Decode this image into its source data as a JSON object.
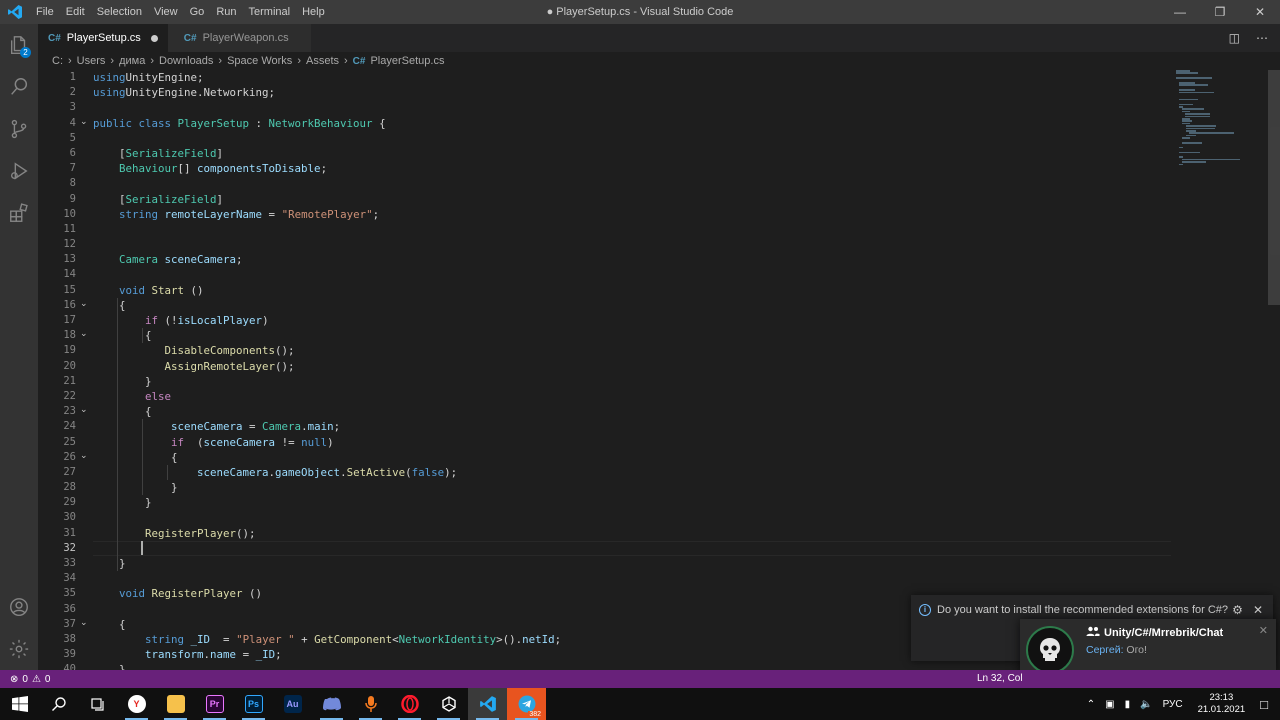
{
  "window": {
    "title": "● PlayerSetup.cs - Visual Studio Code",
    "menu": [
      "File",
      "Edit",
      "Selection",
      "View",
      "Go",
      "Run",
      "Terminal",
      "Help"
    ]
  },
  "activity_bar": {
    "items": [
      "explorer-icon",
      "search-icon",
      "source-control-icon",
      "run-debug-icon",
      "extensions-icon"
    ],
    "explorer_badge": "2",
    "bottom": [
      "account-icon",
      "settings-gear-icon"
    ]
  },
  "tabs": [
    {
      "label": "PlayerSetup.cs",
      "icon": "C#",
      "dirty": true,
      "active": true
    },
    {
      "label": "PlayerWeapon.cs",
      "icon": "C#",
      "dirty": false,
      "active": false
    }
  ],
  "breadcrumb": [
    "C:",
    "Users",
    "дима",
    "Downloads",
    "Space Works",
    "Assets",
    "PlayerSetup.cs"
  ],
  "editor": {
    "current_line": 32,
    "lines": [
      {
        "n": "1",
        "tokens": [
          [
            "kw",
            "using"
          ],
          [
            "",
            "UnityEngine;"
          ]
        ]
      },
      {
        "n": "2",
        "tokens": [
          [
            "kw",
            "using"
          ],
          [
            "",
            "UnityEngine.Networking;"
          ]
        ]
      },
      {
        "n": "3",
        "tokens": []
      },
      {
        "n": "4",
        "tokens": [
          [
            "kw",
            "public class "
          ],
          [
            "ty",
            "PlayerSetup"
          ],
          [
            "",
            " : "
          ],
          [
            "ty",
            "NetworkBehaviour"
          ],
          [
            "",
            " {"
          ]
        ]
      },
      {
        "n": "5",
        "tokens": []
      },
      {
        "n": "6",
        "tokens": [
          [
            "",
            "    ["
          ],
          [
            "ty",
            "SerializeField"
          ],
          [
            "",
            "]"
          ]
        ]
      },
      {
        "n": "7",
        "tokens": [
          [
            "",
            "    "
          ],
          [
            "ty",
            "Behaviour"
          ],
          [
            "",
            "[] "
          ],
          [
            "va",
            "componentsToDisable"
          ],
          [
            "",
            ";"
          ]
        ]
      },
      {
        "n": "8",
        "tokens": []
      },
      {
        "n": "9",
        "tokens": [
          [
            "",
            "    ["
          ],
          [
            "ty",
            "SerializeField"
          ],
          [
            "",
            "]"
          ]
        ]
      },
      {
        "n": "10",
        "tokens": [
          [
            "",
            "    "
          ],
          [
            "kw",
            "string "
          ],
          [
            "va",
            "remoteLayerName"
          ],
          [
            "",
            " = "
          ],
          [
            "st",
            "\"RemotePlayer\""
          ],
          [
            "",
            ";"
          ]
        ]
      },
      {
        "n": "11",
        "tokens": []
      },
      {
        "n": "12",
        "tokens": []
      },
      {
        "n": "13",
        "tokens": [
          [
            "",
            "    "
          ],
          [
            "ty",
            "Camera "
          ],
          [
            "va",
            "sceneCamera"
          ],
          [
            "",
            ";"
          ]
        ]
      },
      {
        "n": "14",
        "tokens": []
      },
      {
        "n": "15",
        "tokens": [
          [
            "",
            "    "
          ],
          [
            "kw",
            "void "
          ],
          [
            "fn",
            "Start"
          ],
          [
            "",
            " ()"
          ]
        ]
      },
      {
        "n": "16",
        "tokens": [
          [
            "",
            "    {"
          ]
        ]
      },
      {
        "n": "17",
        "tokens": [
          [
            "",
            "        "
          ],
          [
            "ct",
            "if"
          ],
          [
            "",
            " (!"
          ],
          [
            "va",
            "isLocalPlayer"
          ],
          [
            "",
            ")"
          ]
        ]
      },
      {
        "n": "18",
        "tokens": [
          [
            "",
            "        {"
          ]
        ]
      },
      {
        "n": "19",
        "tokens": [
          [
            "",
            "           "
          ],
          [
            "fn",
            "DisableComponents"
          ],
          [
            "",
            "();"
          ]
        ]
      },
      {
        "n": "20",
        "tokens": [
          [
            "",
            "           "
          ],
          [
            "fn",
            "AssignRemoteLayer"
          ],
          [
            "",
            "();"
          ]
        ]
      },
      {
        "n": "21",
        "tokens": [
          [
            "",
            "        }"
          ]
        ]
      },
      {
        "n": "22",
        "tokens": [
          [
            "",
            "        "
          ],
          [
            "ct",
            "else"
          ]
        ]
      },
      {
        "n": "23",
        "tokens": [
          [
            "",
            "        {"
          ]
        ]
      },
      {
        "n": "24",
        "tokens": [
          [
            "",
            "            "
          ],
          [
            "va",
            "sceneCamera"
          ],
          [
            "",
            " = "
          ],
          [
            "ty",
            "Camera"
          ],
          [
            "",
            "."
          ],
          [
            "va",
            "main"
          ],
          [
            "",
            ";"
          ]
        ]
      },
      {
        "n": "25",
        "tokens": [
          [
            "",
            "            "
          ],
          [
            "ct",
            "if"
          ],
          [
            "",
            "  ("
          ],
          [
            "va",
            "sceneCamera"
          ],
          [
            "",
            " != "
          ],
          [
            "kw",
            "null"
          ],
          [
            "",
            ")"
          ]
        ]
      },
      {
        "n": "26",
        "tokens": [
          [
            "",
            "            {"
          ]
        ]
      },
      {
        "n": "27",
        "tokens": [
          [
            "",
            "                "
          ],
          [
            "va",
            "sceneCamera"
          ],
          [
            "",
            "."
          ],
          [
            "va",
            "gameObject"
          ],
          [
            "",
            "."
          ],
          [
            "fn",
            "SetActive"
          ],
          [
            "",
            "("
          ],
          [
            "kw",
            "false"
          ],
          [
            "",
            ");"
          ]
        ]
      },
      {
        "n": "28",
        "tokens": [
          [
            "",
            "            }"
          ]
        ]
      },
      {
        "n": "29",
        "tokens": [
          [
            "",
            "        }"
          ]
        ]
      },
      {
        "n": "30",
        "tokens": []
      },
      {
        "n": "31",
        "tokens": [
          [
            "",
            "        "
          ],
          [
            "fn",
            "RegisterPlayer"
          ],
          [
            "",
            "();"
          ]
        ]
      },
      {
        "n": "32",
        "tokens": []
      },
      {
        "n": "33",
        "tokens": [
          [
            "",
            "    }"
          ]
        ]
      },
      {
        "n": "34",
        "tokens": []
      },
      {
        "n": "35",
        "tokens": [
          [
            "",
            "    "
          ],
          [
            "kw",
            "void "
          ],
          [
            "fn",
            "RegisterPlayer"
          ],
          [
            "",
            " ()"
          ]
        ]
      },
      {
        "n": "36",
        "tokens": []
      },
      {
        "n": "37",
        "tokens": [
          [
            "",
            "    {"
          ]
        ]
      },
      {
        "n": "38",
        "tokens": [
          [
            "",
            "        "
          ],
          [
            "kw",
            "string "
          ],
          [
            "va",
            "_ID"
          ],
          [
            "",
            "  = "
          ],
          [
            "st",
            "\"Player \""
          ],
          [
            "",
            " + "
          ],
          [
            "fn",
            "GetComponent"
          ],
          [
            "",
            "<"
          ],
          [
            "ty",
            "NetworkIdentity"
          ],
          [
            "",
            ">()."
          ],
          [
            "va",
            "netId"
          ],
          [
            "",
            ";"
          ]
        ]
      },
      {
        "n": "39",
        "tokens": [
          [
            "",
            "        "
          ],
          [
            "va",
            "transform"
          ],
          [
            "",
            "."
          ],
          [
            "va",
            "name"
          ],
          [
            "",
            " = "
          ],
          [
            "va",
            "_ID"
          ],
          [
            "",
            ";"
          ]
        ]
      },
      {
        "n": "40",
        "tokens": [
          [
            "",
            "    }"
          ]
        ]
      }
    ]
  },
  "notification": {
    "text": "Do you want to install the recommended extensions for C#?",
    "icon": "info-icon",
    "actions": [
      "gear-icon",
      "close-icon"
    ]
  },
  "toast": {
    "title": "Unity/C#/Mrrebrik/Chat",
    "sender": "Сергей:",
    "message": "Ого!",
    "icon": "group-icon"
  },
  "statusbar": {
    "errors": "0",
    "warnings": "0",
    "position": "Ln 32, Col"
  },
  "taskbar": {
    "apps": [
      "windows-start-icon",
      "search-icon",
      "task-view-icon",
      "yandex-browser-icon",
      "file-explorer-icon",
      "premiere-pro-icon",
      "photoshop-icon",
      "audition-icon",
      "discord-icon",
      "audio-app-icon",
      "opera-icon",
      "unity-icon",
      "vscode-icon",
      "telegram-icon"
    ],
    "app_labels": {
      "premiere": "Pr",
      "photoshop": "Ps",
      "audition": "Au",
      "yandex": "Y"
    },
    "telegram_badge": "382",
    "language": "РУС",
    "time": "23:13",
    "date": "21.01.2021"
  },
  "colors": {
    "statusbar": "#68217a",
    "titlebar": "#3c3c3c",
    "activitybar": "#333333",
    "editor_bg": "#1e1e1e",
    "accent": "#007acc"
  }
}
